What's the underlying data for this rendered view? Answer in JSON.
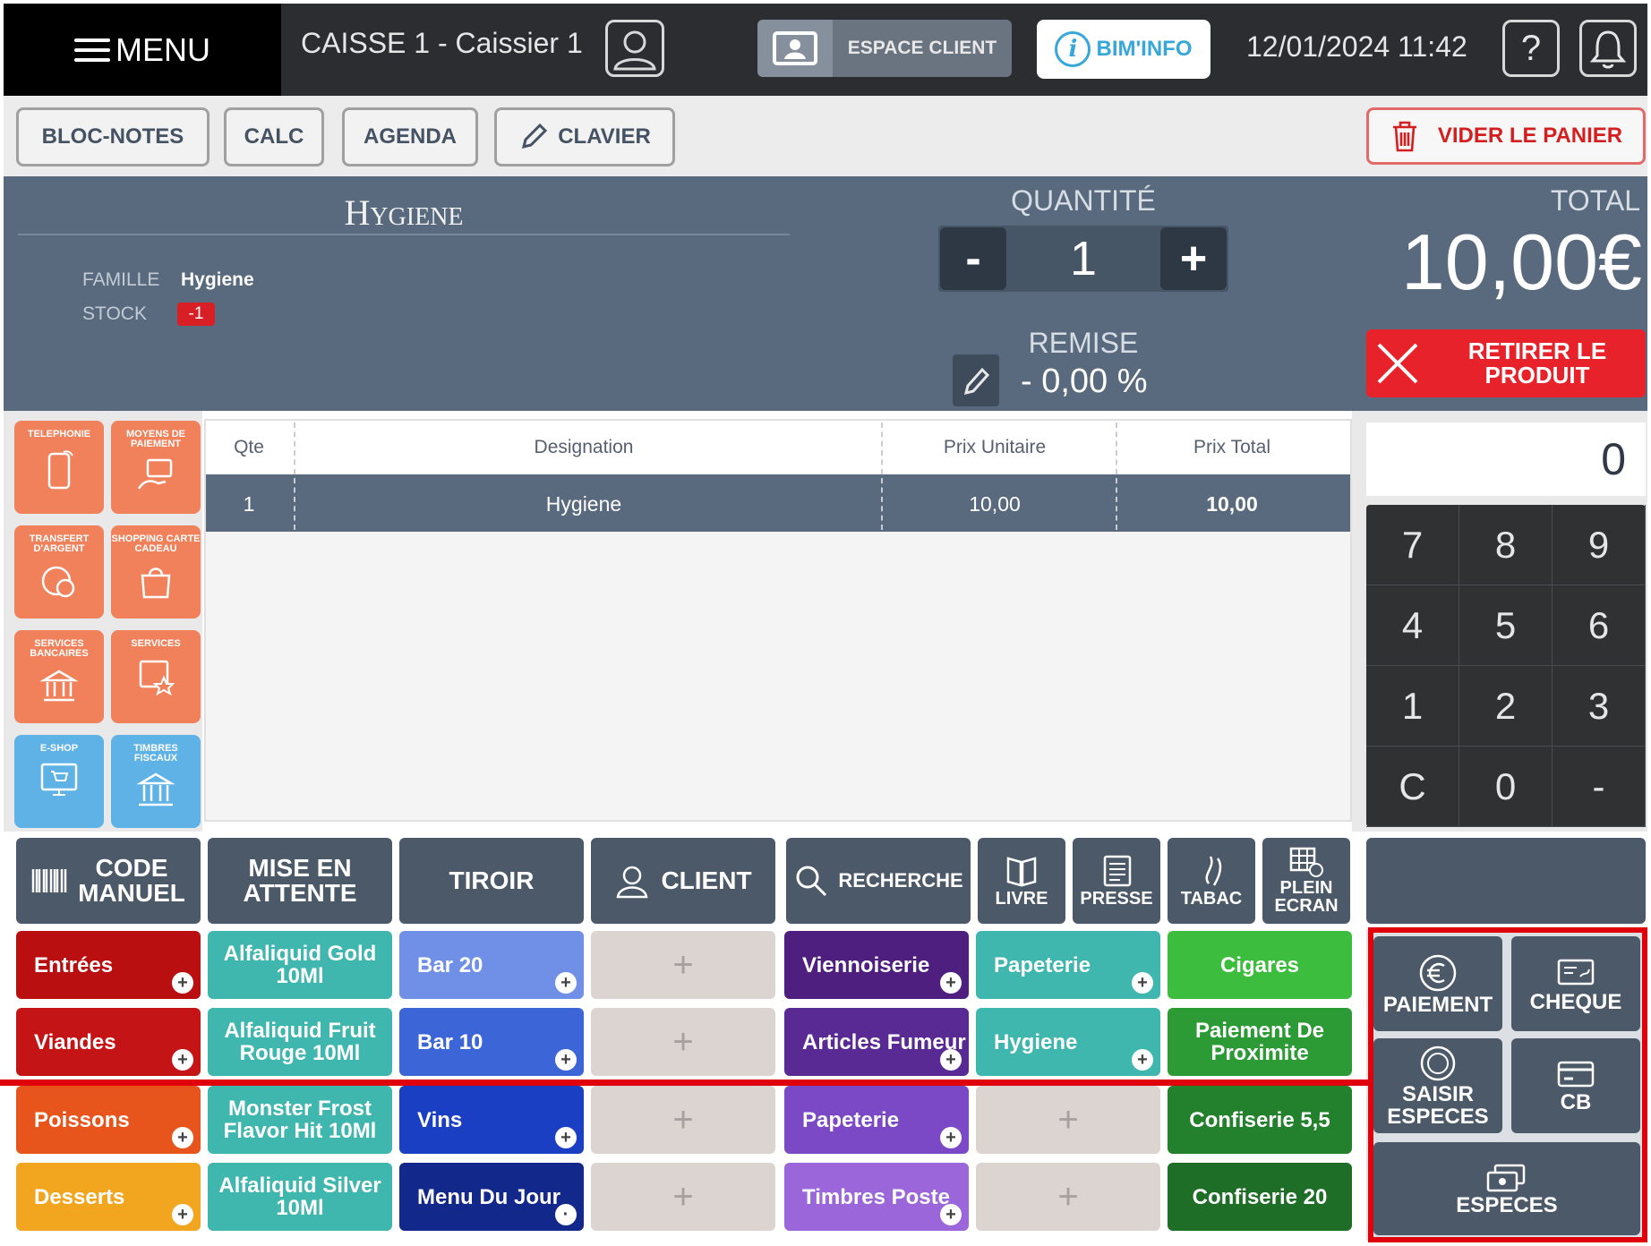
{
  "header": {
    "menu_label": "MENU",
    "caisse_label": "CAISSE 1 - Caissier 1",
    "espace_client": "ESPACE CLIENT",
    "bim_info": "BIM'INFO",
    "datetime": "12/01/2024 11:42",
    "help_glyph": "?"
  },
  "toolbar": {
    "bloc_notes": "BLOC-NOTES",
    "calc": "CALC",
    "agenda": "AGENDA",
    "clavier": "CLAVIER",
    "vider": "VIDER LE PANIER"
  },
  "product": {
    "title": "Hygiene",
    "famille_label": "FAMILLE",
    "famille_value": "Hygiene",
    "stock_label": "STOCK",
    "stock_value": "-1",
    "quantite_label": "QUANTITÉ",
    "minus": "-",
    "plus": "+",
    "quantity": "1",
    "remise_label": "REMISE",
    "remise_value": "- 0,00 %",
    "total_label": "TOTAL",
    "total_value": "10,00€",
    "retirer": "RETIRER LE PRODUIT"
  },
  "shortcuts": [
    {
      "label": "TELEPHONIE",
      "icon": "phone-icon"
    },
    {
      "label": "MOYENS DE PAIEMENT",
      "icon": "payment-hand-icon"
    },
    {
      "label": "TRANSFERT D'ARGENT",
      "icon": "money-transfer-icon"
    },
    {
      "label": "SHOPPING CARTE CADEAU",
      "icon": "gift-card-bag-icon"
    },
    {
      "label": "SERVICES BANCAIRES",
      "icon": "bank-icon"
    },
    {
      "label": "SERVICES",
      "icon": "services-star-icon"
    },
    {
      "label": "E-SHOP",
      "icon": "eshop-cart-icon"
    },
    {
      "label": "TIMBRES FISCAUX",
      "icon": "tax-stamp-bank-icon"
    }
  ],
  "table": {
    "headers": [
      "Qte",
      "Designation",
      "Prix Unitaire",
      "Prix Total"
    ],
    "rows": [
      {
        "qte": "1",
        "designation": "Hygiene",
        "prix_unitaire": "10,00",
        "prix_total": "10,00"
      }
    ]
  },
  "numpad": {
    "display": "0",
    "keys": [
      "7",
      "8",
      "9",
      "4",
      "5",
      "6",
      "1",
      "2",
      "3",
      "C",
      "0",
      "-"
    ]
  },
  "functions": {
    "code_manuel": "CODE MANUEL",
    "mise_en_attente": "MISE EN ATTENTE",
    "tiroir": "TIROIR",
    "client": "CLIENT",
    "recherche": "RECHERCHE",
    "livre": "LIVRE",
    "presse": "PRESSE",
    "tabac": "TABAC",
    "plein_ecran": "PLEIN ECRAN"
  },
  "categories": {
    "col1": [
      "Entrées",
      "Viandes",
      "Poissons",
      "Desserts"
    ],
    "col2": [
      "Alfaliquid Gold 10Ml",
      "Alfaliquid Fruit Rouge 10Ml",
      "Monster Frost Flavor Hit 10Ml",
      "Alfaliquid Silver 10Ml"
    ],
    "col3": [
      "Bar 20",
      "Bar 10",
      "Vins",
      "Menu Du Jour"
    ],
    "col4": [
      "+",
      "+",
      "+",
      "+"
    ],
    "col5": [
      "Viennoiserie",
      "Articles Fumeur",
      "Papeterie",
      "Timbres Poste"
    ],
    "col6": [
      "Papeterie",
      "Hygiene",
      "+",
      "+"
    ],
    "col7": [
      "Cigares",
      "Paiement De Proximite",
      "Confiserie 5,5",
      "Confiserie 20"
    ]
  },
  "payment": {
    "paiement": "PAIEMENT",
    "cheque": "CHEQUE",
    "saisir_especes": "SAISIR ESPECES",
    "cb": "CB",
    "especes": "ESPECES"
  },
  "colors": {
    "header_bg": "#2b2d31",
    "product_panel": "#5a6a7e",
    "accent_red": "#e8222a",
    "highlight_red": "#e0000b",
    "shortcut_orange": "#f0815b",
    "shortcut_blue": "#5fb2e6"
  }
}
